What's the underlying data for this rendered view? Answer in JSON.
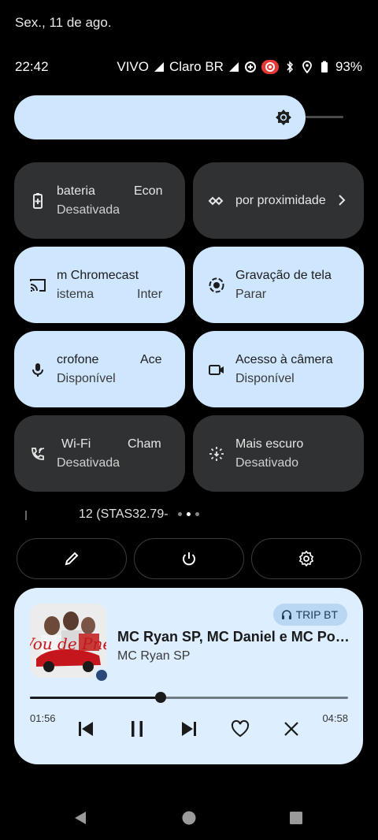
{
  "date": "Sex., 11 de ago.",
  "status_bar": {
    "time": "22:42",
    "carrier1": "VIVO",
    "carrier2": "Claro BR",
    "battery": "93%"
  },
  "tiles": [
    {
      "title": "bateria",
      "title_peek": "Econ",
      "state": "Desativada",
      "icon": "battery-saver-icon",
      "style": "dark"
    },
    {
      "title": "por proximidade",
      "state": "",
      "icon": "nearby-share-icon",
      "style": "dark"
    },
    {
      "title": "m Chromecast",
      "state": "istema",
      "state_peek": "Inter",
      "icon": "cast-icon",
      "style": "light"
    },
    {
      "title": "Gravação de tela",
      "state": "Parar",
      "icon": "screen-record-icon",
      "style": "light"
    },
    {
      "title": "crofone",
      "title_peek": "Ace",
      "state": "Disponível",
      "icon": "microphone-icon",
      "style": "light"
    },
    {
      "title": "Acesso à câmera",
      "state": "Disponível",
      "icon": "camera-icon",
      "style": "light"
    },
    {
      "title": "Wi-Fi",
      "title_peek": "Cham",
      "state": "Desativada",
      "icon": "wifi-calling-icon",
      "style": "dark"
    },
    {
      "title": "Mais escuro",
      "state": "Desativado",
      "icon": "extra-dim-icon",
      "style": "dark"
    }
  ],
  "build_number": "12 (STAS32.79-",
  "media": {
    "output_device": "TRIP BT",
    "title": "MC Ryan SP, MC Daniel e MC Poze do Rodo",
    "artist": "MC Ryan SP",
    "elapsed": "01:56",
    "total": "04:58",
    "progress": 0.41,
    "album_art_text": "Vou de Pnelle"
  },
  "colors": {
    "tile_active": "#cfe6ff",
    "tile_inactive": "#2f3133",
    "media_bg": "#dceeff"
  }
}
